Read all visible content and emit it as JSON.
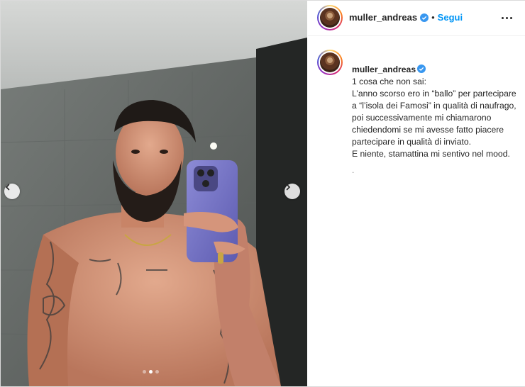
{
  "post": {
    "username": "muller_andreas",
    "verified": true,
    "follow_label": "Segui",
    "separator": "•",
    "more_icon": "more-horizontal-icon",
    "caption_first_line": "1 cosa che non sai:",
    "caption_body": "L’anno scorso ero in “ballo” per partecipare a “l’isola dei Famosi” in qualità di naufrago, poi successivamente mi chiamarono chiedendomi se mi avesse fatto piacere partecipare in qualità di inviato.\nE niente, stamattina mi sentivo nel mood.",
    "caption_tail": ".",
    "carousel": {
      "total": 3,
      "active_index": 1
    },
    "colors": {
      "accent": "#0095f6",
      "verified": "#3897f0"
    }
  }
}
